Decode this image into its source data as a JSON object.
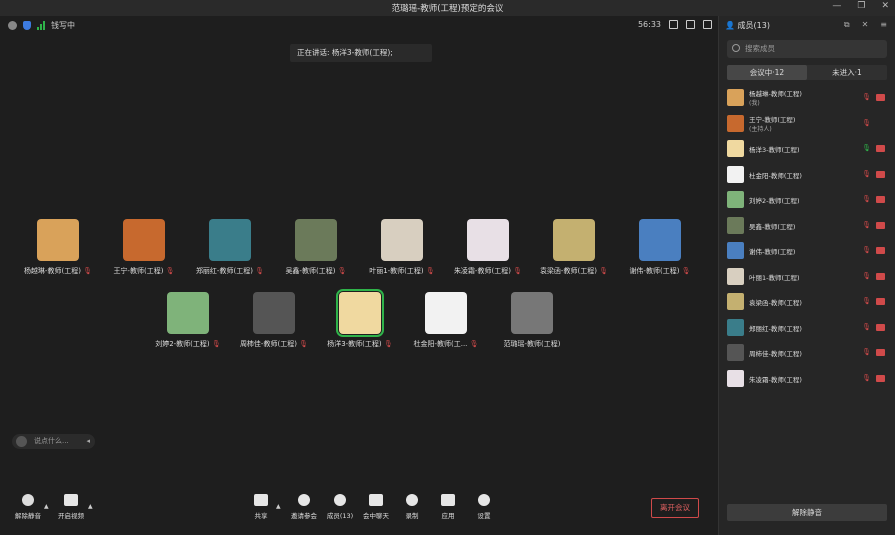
{
  "window": {
    "title": "范璐瑶-教师(工程)预定的会议"
  },
  "topbar": {
    "status": "钱写中",
    "time": "56:33"
  },
  "speaking": "正在讲话: 杨洋3-教师(工程);",
  "tiles": [
    {
      "name": "杨越琳-教师(工程)",
      "color": "#d9a25a"
    },
    {
      "name": "王宁-教师(工程)",
      "color": "#c7692e"
    },
    {
      "name": "郑丽红-教师(工程)",
      "color": "#3a7d8a"
    },
    {
      "name": "吴鑫-教师(工程)",
      "color": "#6b7a5a"
    },
    {
      "name": "叶丽1-教师(工程)",
      "color": "#d8cfc0"
    },
    {
      "name": "朱凌霜-教师(工程)",
      "color": "#e8e0e6"
    },
    {
      "name": "袁梁函-教师(工程)",
      "color": "#c4b070"
    },
    {
      "name": "谢伟-教师(工程)",
      "color": "#4a7fc0"
    },
    {
      "name": "刘婷2-教师(工程)",
      "color": "#7fb37a"
    },
    {
      "name": "周柿佳-教师(工程)",
      "color": "#555"
    },
    {
      "name": "杨洋3-教师(工程)",
      "color": "#f0d9a0"
    },
    {
      "name": "杜金阳-教师(工...",
      "color": "#f2f2f2"
    },
    {
      "name": "范璐瑶-教师(工程)",
      "color": "#777"
    }
  ],
  "chat": {
    "placeholder": "说点什么..."
  },
  "toolbar": {
    "unmute": "解除静音",
    "video": "开启视频",
    "share": "共享",
    "invite": "邀请参会",
    "members": "成员(13)",
    "chat": "会中聊天",
    "record": "录制",
    "apps": "应用",
    "settings": "设置",
    "leave": "离开会议"
  },
  "panel": {
    "title": "成员(13)",
    "search_placeholder": "搜索成员",
    "tab_in": "会议中·12",
    "tab_out": "未进入·1",
    "unmute_all": "解除静音",
    "members": [
      {
        "name": "杨越琳-教师(工程)",
        "sub": "(我)",
        "color": "#d9a25a",
        "mic": "muted"
      },
      {
        "name": "王宁-教师(工程)",
        "sub": "(主持人)",
        "color": "#c7692e",
        "mic": "muted"
      },
      {
        "name": "杨洋3-教师(工程)",
        "sub": "",
        "color": "#f0d9a0",
        "mic": "on"
      },
      {
        "name": "杜金阳-教师(工程)",
        "sub": "",
        "color": "#f2f2f2",
        "mic": "muted"
      },
      {
        "name": "刘婷2-教师(工程)",
        "sub": "",
        "color": "#7fb37a",
        "mic": "muted"
      },
      {
        "name": "吴鑫-教师(工程)",
        "sub": "",
        "color": "#6b7a5a",
        "mic": "muted"
      },
      {
        "name": "谢伟-教师(工程)",
        "sub": "",
        "color": "#4a7fc0",
        "mic": "muted"
      },
      {
        "name": "叶丽1-教师(工程)",
        "sub": "",
        "color": "#d8cfc0",
        "mic": "muted"
      },
      {
        "name": "袁梁函-教师(工程)",
        "sub": "",
        "color": "#c4b070",
        "mic": "muted"
      },
      {
        "name": "郑丽红-教师(工程)",
        "sub": "",
        "color": "#3a7d8a",
        "mic": "muted"
      },
      {
        "name": "周柿佳-教师(工程)",
        "sub": "",
        "color": "#555",
        "mic": "muted"
      },
      {
        "name": "朱凌霜-教师(工程)",
        "sub": "",
        "color": "#e8e0e6",
        "mic": "muted"
      }
    ]
  },
  "colors": {
    "accent_green": "#2fb34a",
    "danger": "#d04a4a"
  }
}
